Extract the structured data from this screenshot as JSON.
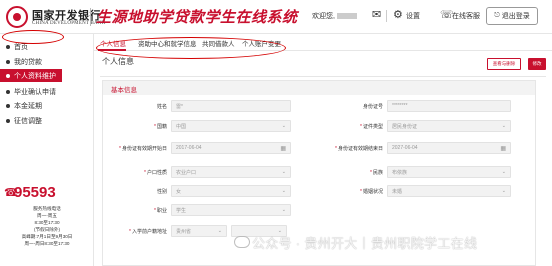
{
  "header": {
    "bank_name_cn": "国家开发银行",
    "bank_name_en": "CHINA DEVELOPMENT BANK",
    "system_title": "生源地助学贷款学生在线系统",
    "welcome": "欢迎您,",
    "settings_label": "设置",
    "online_service_label": "在线客服",
    "logout_label": "退出登录"
  },
  "sidebar": {
    "items": [
      {
        "label": "首页"
      },
      {
        "label": "我的贷款"
      },
      {
        "label": "个人资料维护"
      },
      {
        "label": "毕业确认申请"
      },
      {
        "label": "本金延期"
      },
      {
        "label": "征信调整"
      }
    ],
    "active_index": 2,
    "hotline": "95593",
    "hotline_info": [
      "服务热线电话",
      "周一-周五",
      "8:30至17:30",
      "(节假日除外)",
      "高峰期:7月1日至9月30日",
      "周一-周日8:30至17:30"
    ]
  },
  "tabs": [
    {
      "label": "个人信息",
      "active": true
    },
    {
      "label": "资助中心和就学信息",
      "active": false
    },
    {
      "label": "共同借款人",
      "active": false
    },
    {
      "label": "个人账户变更",
      "active": false
    }
  ],
  "main": {
    "section_title": "个人信息",
    "btn_apply": "查看与删除",
    "btn_edit": "修改",
    "card_title": "基本信息"
  },
  "form": {
    "name": {
      "label": "姓名",
      "value": "雷*"
    },
    "id_number": {
      "label": "身份证号",
      "value": "********"
    },
    "nationality": {
      "label": "国籍",
      "value": "中国"
    },
    "id_type": {
      "label": "证件类型",
      "value": "居民身份证"
    },
    "id_start": {
      "label": "身份证有效期开始日",
      "value": "2017-06-04"
    },
    "id_end": {
      "label": "身份证有效期结束日",
      "value": "2027-06-04"
    },
    "hukou": {
      "label": "户口性质",
      "value": "农业户口"
    },
    "ethnicity": {
      "label": "民族",
      "value": "布依族"
    },
    "gender": {
      "label": "性别",
      "value": "女"
    },
    "marital": {
      "label": "婚姻状况",
      "value": "未婚"
    },
    "occupation": {
      "label": "职业",
      "value": "学生"
    },
    "address": {
      "label": "入学前户籍地址",
      "value": "贵州省"
    }
  },
  "watermark": "公众号 · 贵州开大丨贵州职院学工在线",
  "colors": {
    "accent": "#c8102e",
    "annotation": "#d40000"
  }
}
